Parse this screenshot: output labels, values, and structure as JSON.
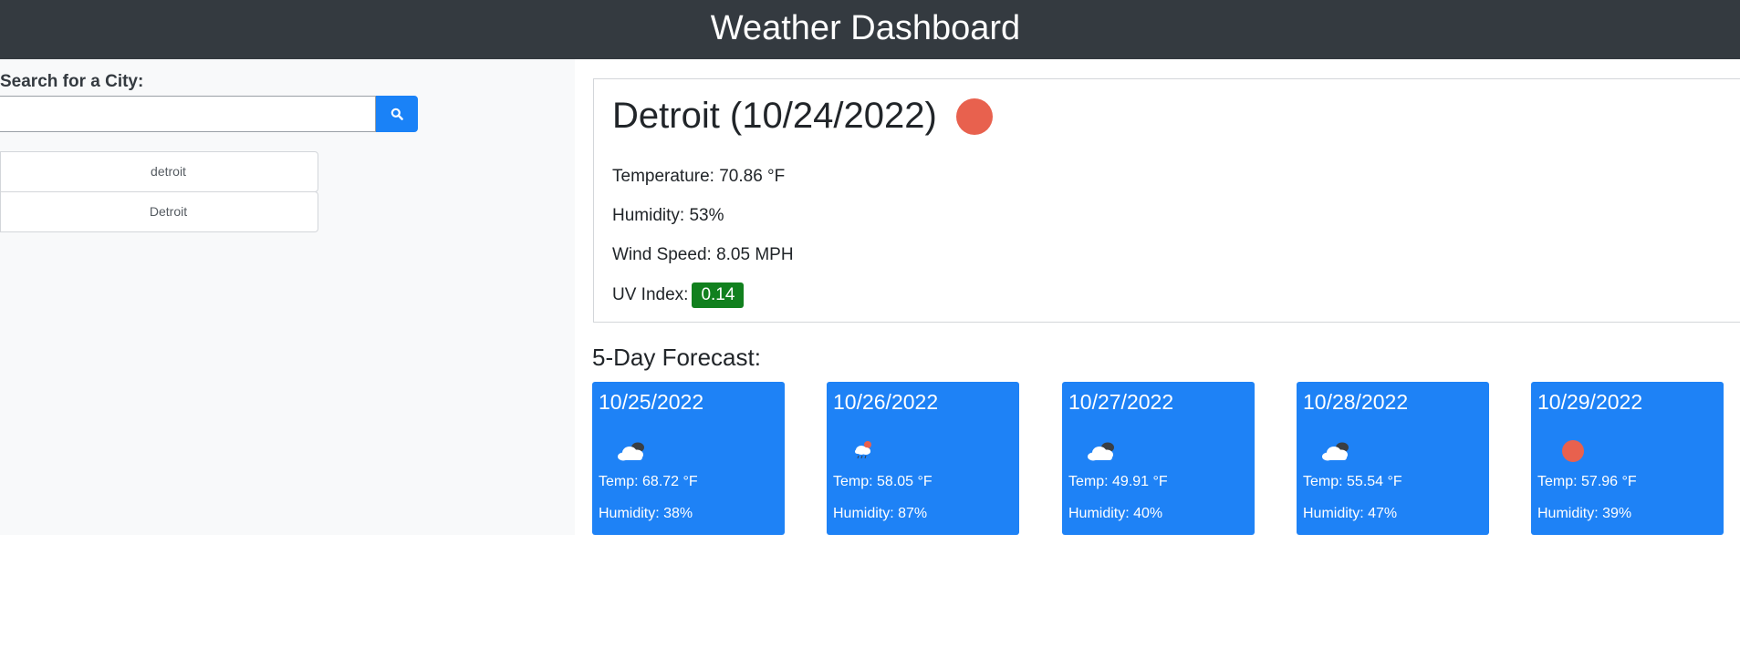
{
  "header": {
    "title": "Weather Dashboard"
  },
  "search": {
    "label": "Search for a City:",
    "value": "",
    "placeholder": "",
    "button_icon": "search-icon"
  },
  "history": [
    "detroit",
    "Detroit"
  ],
  "current": {
    "title": "Detroit (10/24/2022)",
    "icon": "sun-icon",
    "temperature": "Temperature: 70.86 °F",
    "humidity": "Humidity: 53%",
    "wind": "Wind Speed: 8.05 MPH",
    "uv_label": "UV Index:",
    "uv_value": "0.14",
    "uv_color": "#11801e"
  },
  "forecast": {
    "title": "5-Day Forecast:",
    "days": [
      {
        "date": "10/25/2022",
        "icon": "cloud-icon",
        "temp": "Temp: 68.72 °F",
        "humidity": "Humidity: 38%"
      },
      {
        "date": "10/26/2022",
        "icon": "rain-icon",
        "temp": "Temp: 58.05 °F",
        "humidity": "Humidity: 87%"
      },
      {
        "date": "10/27/2022",
        "icon": "cloud-icon",
        "temp": "Temp: 49.91 °F",
        "humidity": "Humidity: 40%"
      },
      {
        "date": "10/28/2022",
        "icon": "cloud-icon",
        "temp": "Temp: 55.54 °F",
        "humidity": "Humidity: 47%"
      },
      {
        "date": "10/29/2022",
        "icon": "sun-icon",
        "temp": "Temp: 57.96 °F",
        "humidity": "Humidity: 39%"
      }
    ]
  },
  "colors": {
    "header_bg": "#343a40",
    "accent": "#1e82f6",
    "sun": "#e8614e"
  }
}
